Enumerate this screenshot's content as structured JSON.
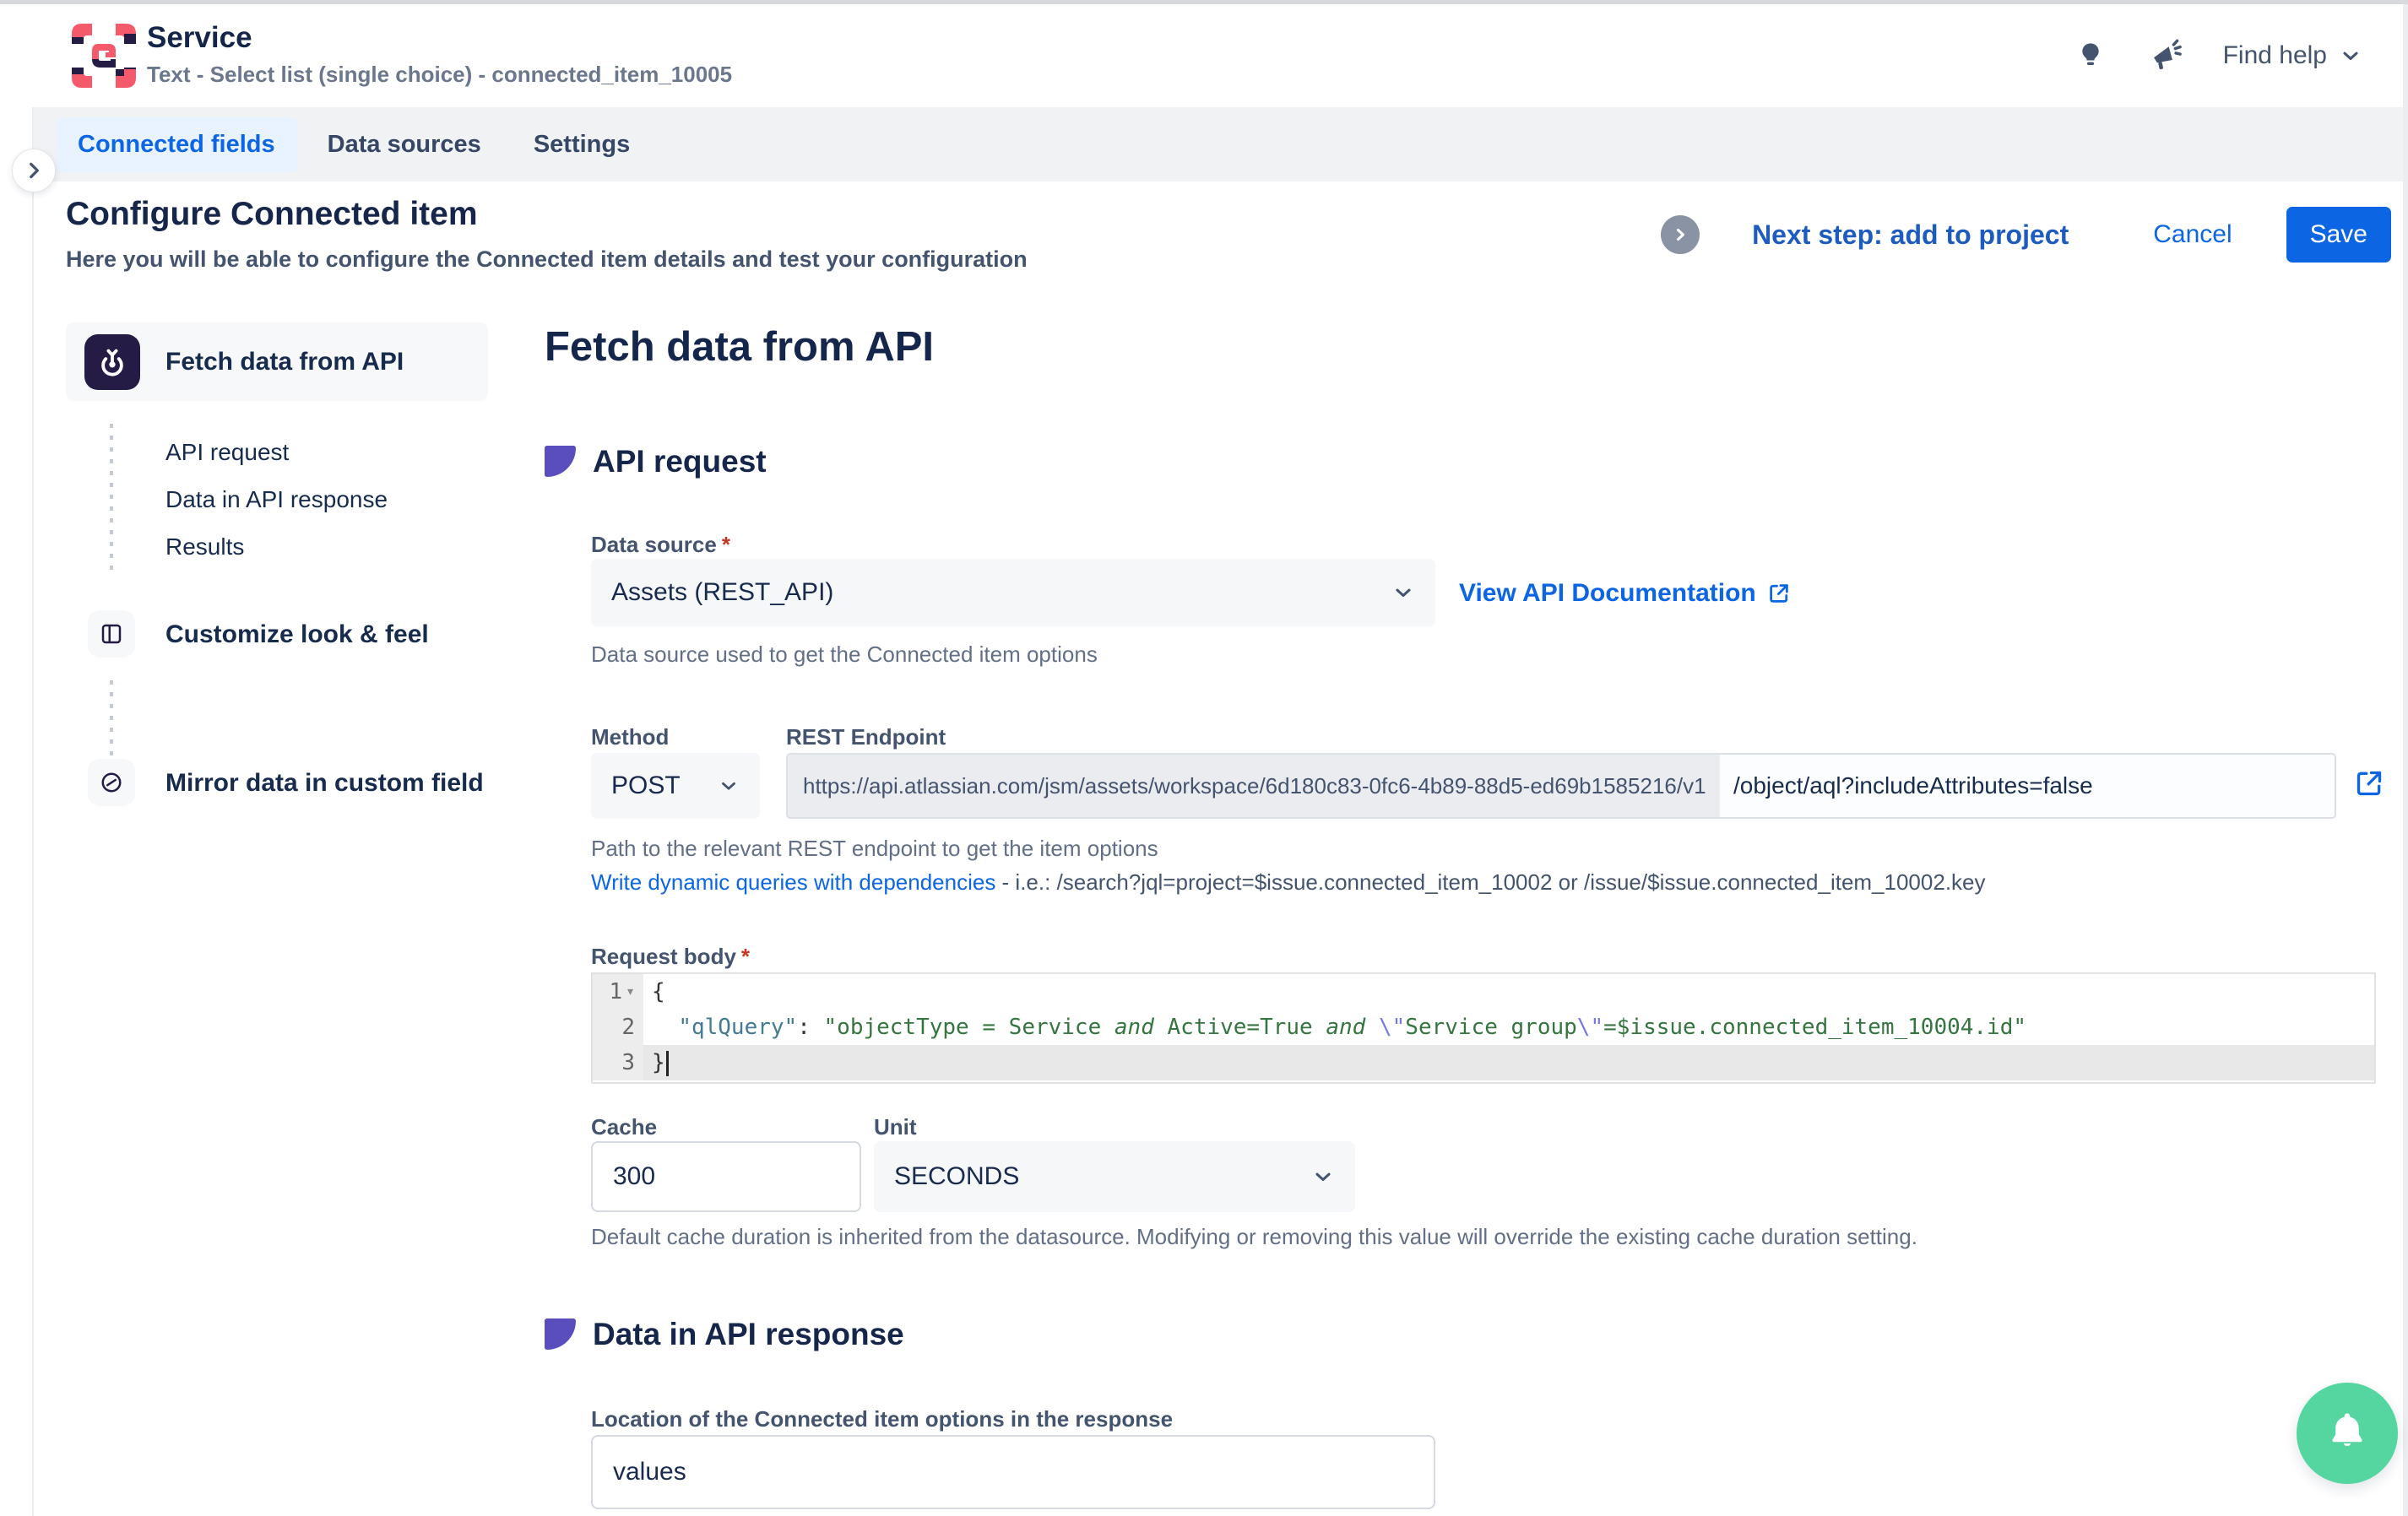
{
  "header": {
    "title": "Service",
    "subtitle": "Text - Select list (single choice) - connected_item_10005",
    "find_help_label": "Find help"
  },
  "tabs": [
    {
      "label": "Connected fields"
    },
    {
      "label": "Data sources"
    },
    {
      "label": "Settings"
    }
  ],
  "config_header": {
    "title": "Configure Connected item",
    "subtitle": "Here you will be able to configure the Connected item details and test your configuration",
    "next_step_label": "Next step: add to project",
    "cancel_label": "Cancel",
    "save_label": "Save"
  },
  "steps": {
    "step1_label": "Fetch data from API",
    "sub": [
      {
        "label": "API request"
      },
      {
        "label": "Data in API response"
      },
      {
        "label": "Results"
      }
    ],
    "step2_label": "Customize look & feel",
    "step3_label": "Mirror data in custom field"
  },
  "misc": {
    "required_marker": "*"
  },
  "main": {
    "heading": "Fetch data from API",
    "api_request": {
      "section_title": "API request",
      "data_source_label": "Data source",
      "data_source_value": "Assets (REST_API)",
      "view_api_doc_label": "View API Documentation",
      "data_source_help": "Data source used to get the Connected item options",
      "method_label": "Method",
      "method_value": "POST",
      "endpoint_label": "REST Endpoint",
      "endpoint_base": "https://api.atlassian.com/jsm/assets/workspace/6d180c83-0fc6-4b89-88d5-ed69b1585216/v1",
      "endpoint_path": "/object/aql?includeAttributes=false",
      "endpoint_help": "Path to the relevant REST endpoint to get the item options",
      "dynamic_link_label": "Write dynamic queries with dependencies",
      "dynamic_link_suffix": " - i.e.: /search?jql=project=$issue.connected_item_10002 or /issue/$issue.connected_item_10002.key",
      "request_body_label": "Request body",
      "editor": {
        "line_numbers": [
          "1",
          "2",
          "3"
        ],
        "line1": "{",
        "line3": "}",
        "line2": {
          "indent": "  ",
          "key": "\"qlQuery\"",
          "colon": ": ",
          "s1": "\"objectType = Service ",
          "and1": "and",
          "s2": " Active=True ",
          "and2": "and",
          "s3": " ",
          "esc1": "\\\"",
          "s4": "Service group",
          "esc2": "\\\"",
          "s5": "=$issue.connected_item_10004.id",
          "close": "\""
        }
      },
      "cache_label": "Cache",
      "cache_value": "300",
      "unit_label": "Unit",
      "unit_value": "SECONDS",
      "cache_help": "Default cache duration is inherited from the datasource. Modifying or removing this value will override the existing cache duration setting."
    },
    "api_response": {
      "section_title": "Data in API response",
      "location_label": "Location of the Connected item options in the response",
      "location_value": "values"
    }
  },
  "colors": {
    "accent_blue": "#0C66E4",
    "accent_purple": "#5A4DBE",
    "success_green": "#55D6A0",
    "brand_red": "#F4596C",
    "brand_navy": "#241C45",
    "tabstrip_bg": "#F1F2F4",
    "active_tab_bg": "#E9F2FF"
  }
}
